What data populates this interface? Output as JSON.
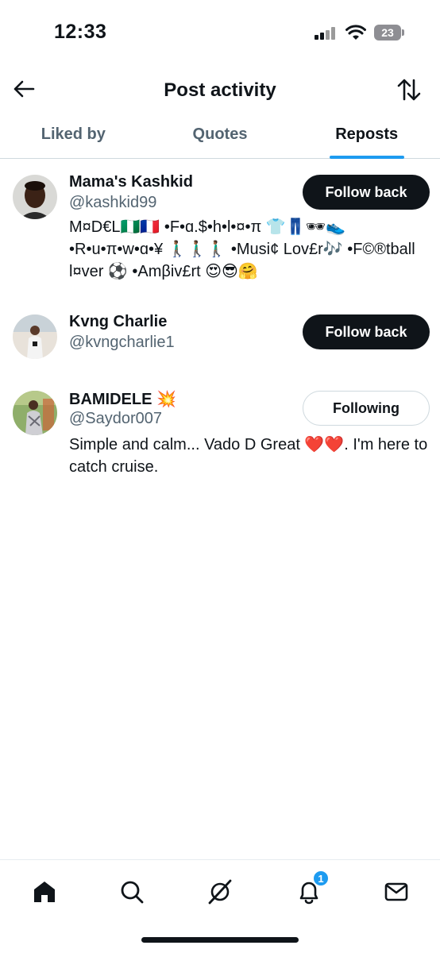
{
  "status_bar": {
    "time": "12:33",
    "battery": "23"
  },
  "header": {
    "title": "Post activity"
  },
  "tabs": [
    {
      "label": "Liked by",
      "active": false
    },
    {
      "label": "Quotes",
      "active": false
    },
    {
      "label": "Reposts",
      "active": true
    }
  ],
  "users": [
    {
      "name": "Mama's Kashkid",
      "handle": "@kashkid99",
      "bio": "M¤D€L🇳🇬🇫🇷 •F•ɑ.$•h•l•¤•π 👕👖🕶👟 •R•u•π•w•ɑ•¥ 🚶🏾‍♂️🚶🏾‍♂️🚶🏾‍♂️ •Musi¢ Lov£r🎶 •F©®tball l¤ver ⚽️ •Amβiv£rt 😍😎🤗",
      "button": "Follow back"
    },
    {
      "name": "Kvng Charlie",
      "handle": "@kvngcharlie1",
      "bio": "",
      "button": "Follow back"
    },
    {
      "name": "BAMIDELE 💥",
      "handle": "@Saydor007",
      "bio": "Simple and calm... Vado D Great ❤️❤️. I'm here to catch cruise.",
      "button": "Following"
    }
  ],
  "nav": {
    "items": [
      "home-icon",
      "search-icon",
      "grok-icon",
      "notifications-icon",
      "messages-icon"
    ],
    "notification_count": "1"
  },
  "colors": {
    "accent": "#1d9bf0",
    "text": "#0f1419",
    "secondary": "#536471",
    "border": "#cfd9de"
  }
}
